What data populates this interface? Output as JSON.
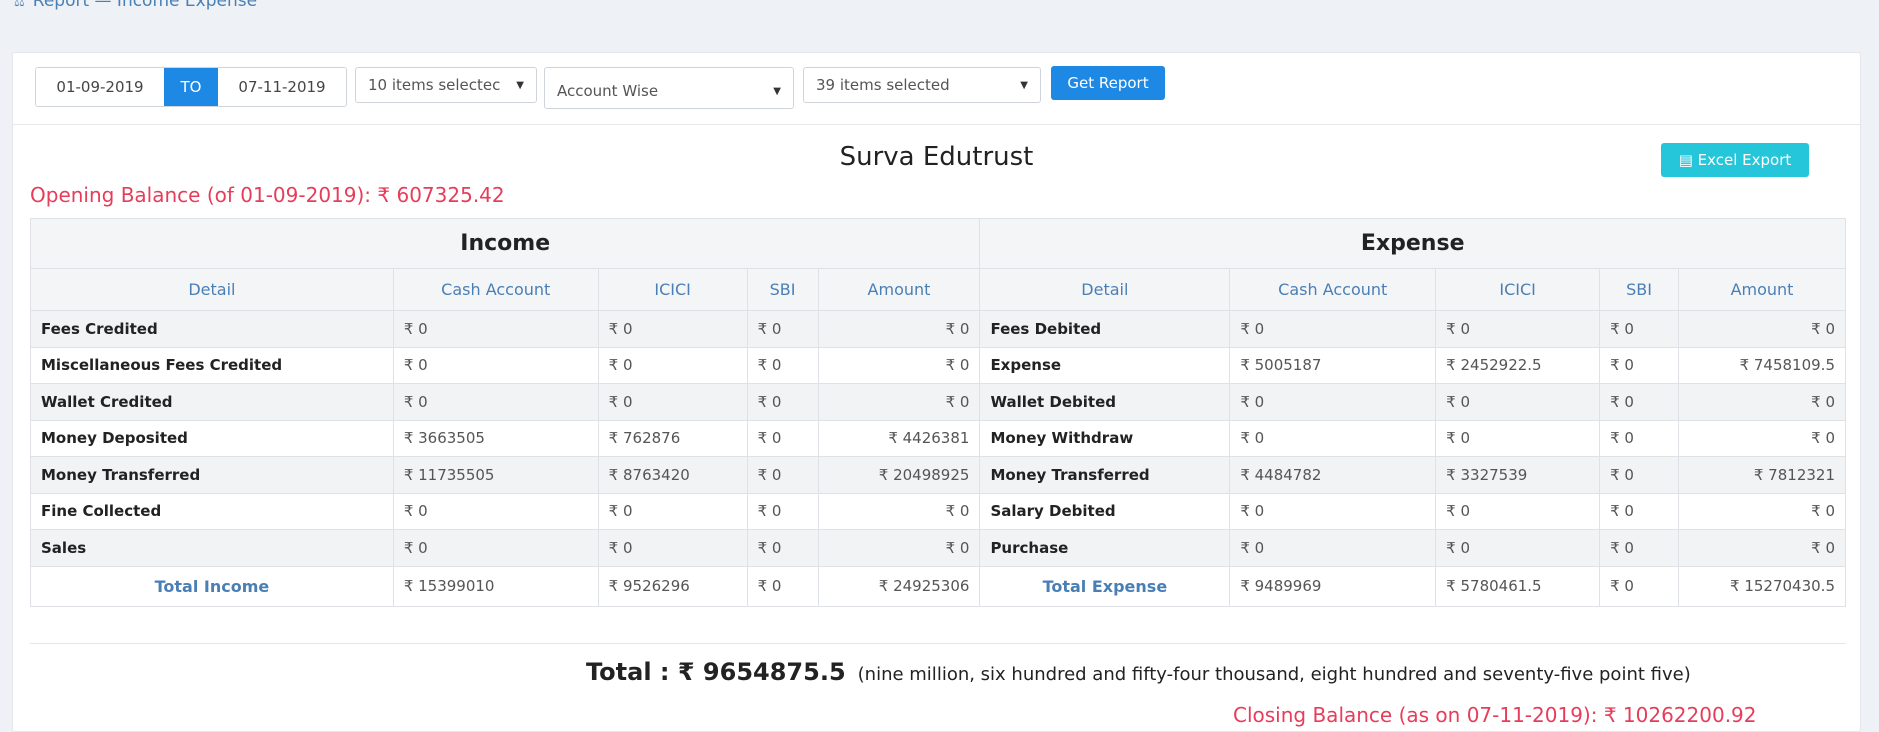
{
  "header": {
    "title": "Report — Income Expense"
  },
  "filters": {
    "from_date": "01-09-2019",
    "to_label": "TO",
    "to_date": "07-11-2019",
    "items_select_1": "10 items selectec",
    "account_mode": "Account Wise",
    "items_select_2": "39 items selected",
    "get_report_label": "Get Report"
  },
  "report": {
    "company": "Surva Edutrust",
    "excel_export_label": "Excel Export",
    "opening_balance": "Opening Balance (of 01-09-2019): ₹ 607325.42",
    "income_title": "Income",
    "expense_title": "Expense",
    "columns": [
      "Detail",
      "Cash Account",
      "ICICI",
      "SBI",
      "Amount"
    ],
    "rows": [
      {
        "income": [
          "Fees Credited",
          "₹ 0",
          "₹ 0",
          "₹ 0",
          "₹ 0"
        ],
        "expense": [
          "Fees Debited",
          "₹ 0",
          "₹ 0",
          "₹ 0",
          "₹ 0"
        ]
      },
      {
        "income": [
          "Miscellaneous Fees Credited",
          "₹ 0",
          "₹ 0",
          "₹ 0",
          "₹ 0"
        ],
        "expense": [
          "Expense",
          "₹ 5005187",
          "₹ 2452922.5",
          "₹ 0",
          "₹ 7458109.5"
        ]
      },
      {
        "income": [
          "Wallet Credited",
          "₹ 0",
          "₹ 0",
          "₹ 0",
          "₹ 0"
        ],
        "expense": [
          "Wallet Debited",
          "₹ 0",
          "₹ 0",
          "₹ 0",
          "₹ 0"
        ]
      },
      {
        "income": [
          "Money Deposited",
          "₹ 3663505",
          "₹ 762876",
          "₹ 0",
          "₹ 4426381"
        ],
        "expense": [
          "Money Withdraw",
          "₹ 0",
          "₹ 0",
          "₹ 0",
          "₹ 0"
        ]
      },
      {
        "income": [
          "Money Transferred",
          "₹ 11735505",
          "₹ 8763420",
          "₹ 0",
          "₹ 20498925"
        ],
        "expense": [
          "Money Transferred",
          "₹ 4484782",
          "₹ 3327539",
          "₹ 0",
          "₹ 7812321"
        ]
      },
      {
        "income": [
          "Fine Collected",
          "₹ 0",
          "₹ 0",
          "₹ 0",
          "₹ 0"
        ],
        "expense": [
          "Salary Debited",
          "₹ 0",
          "₹ 0",
          "₹ 0",
          "₹ 0"
        ]
      },
      {
        "income": [
          "Sales",
          "₹ 0",
          "₹ 0",
          "₹ 0",
          "₹ 0"
        ],
        "expense": [
          "Purchase",
          "₹ 0",
          "₹ 0",
          "₹ 0",
          "₹ 0"
        ]
      }
    ],
    "totals": {
      "income": [
        "Total Income",
        "₹ 15399010",
        "₹ 9526296",
        "₹ 0",
        "₹ 24925306"
      ],
      "expense": [
        "Total Expense",
        "₹ 9489969",
        "₹ 5780461.5",
        "₹ 0",
        "₹ 15270430.5"
      ]
    },
    "grand_total": "Total : ₹ 9654875.5",
    "grand_total_words": "(nine million, six hundred and fifty-four thousand, eight hundred and seventy-five point five)",
    "closing_balance": "Closing Balance (as on 07-11-2019): ₹ 10262200.92"
  },
  "icons": {
    "heading_icon": "balance-scale-icon",
    "excel_icon": "file-icon",
    "caret_icon": "caret-down-icon"
  }
}
